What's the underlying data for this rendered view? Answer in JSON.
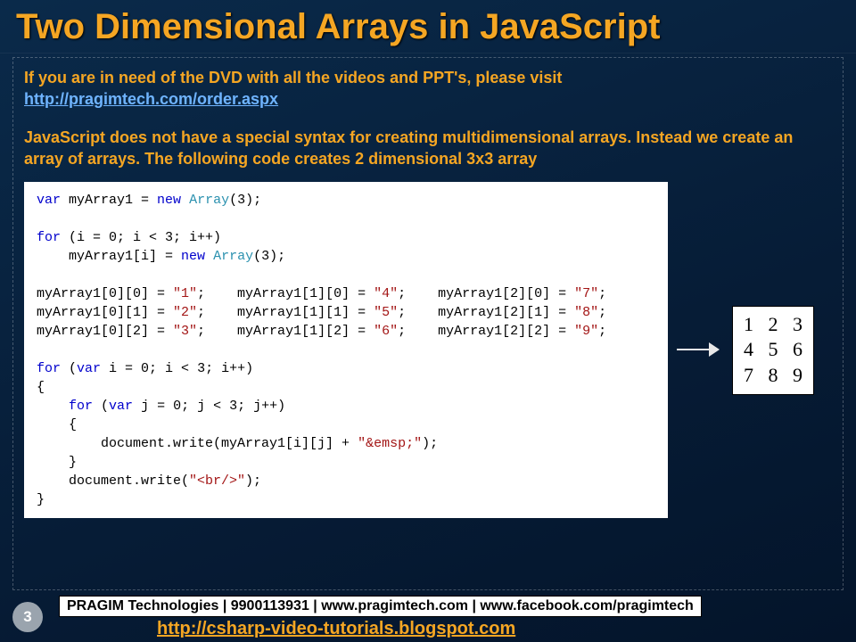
{
  "title": "Two Dimensional Arrays in JavaScript",
  "intro": {
    "line1": "If you are in need of the DVD with all the videos and PPT's, please visit",
    "link_text": "http://pragimtech.com/order.aspx",
    "line2a": "JavaScript does not have a special syntax for creating multidimensional arrays. Instead we create ",
    "line2b": "an array of arrays.",
    "line2c": " The following code creates 2 dimensional 3x3 array"
  },
  "code": {
    "l1a": "var",
    "l1b": " myArray1 = ",
    "l1c": "new",
    "l1d": " ",
    "l1e": "Array",
    "l1f": "(3);",
    "l3a": "for",
    "l3b": " (i = 0; i < 3; i++)",
    "l4a": "    myArray1[i] = ",
    "l4b": "new",
    "l4c": " ",
    "l4d": "Array",
    "l4e": "(3);",
    "l6a": "myArray1[0][0] = ",
    "l6b": "\"1\"",
    "l6c": ";    myArray1[1][0] = ",
    "l6d": "\"4\"",
    "l6e": ";    myArray1[2][0] = ",
    "l6f": "\"7\"",
    "l6g": ";",
    "l7a": "myArray1[0][1] = ",
    "l7b": "\"2\"",
    "l7c": ";    myArray1[1][1] = ",
    "l7d": "\"5\"",
    "l7e": ";    myArray1[2][1] = ",
    "l7f": "\"8\"",
    "l7g": ";",
    "l8a": "myArray1[0][2] = ",
    "l8b": "\"3\"",
    "l8c": ";    myArray1[1][2] = ",
    "l8d": "\"6\"",
    "l8e": ";    myArray1[2][2] = ",
    "l8f": "\"9\"",
    "l8g": ";",
    "l10a": "for",
    "l10b": " (",
    "l10c": "var",
    "l10d": " i = 0; i < 3; i++)",
    "l11": "{",
    "l12a": "    ",
    "l12b": "for",
    "l12c": " (",
    "l12d": "var",
    "l12e": " j = 0; j < 3; j++)",
    "l13": "    {",
    "l14a": "        document.write(myArray1[i][j] + ",
    "l14b": "\"&emsp;\"",
    "l14c": ");",
    "l15": "    }",
    "l16a": "    document.write(",
    "l16b": "\"<br/>\"",
    "l16c": ");",
    "l17": "}"
  },
  "output": {
    "r1": "1   2   3",
    "r2": "4   5   6",
    "r3": "7   8   9"
  },
  "footer": {
    "page": "3",
    "info": "PRAGIM Technologies | 9900113931 | www.pragimtech.com | www.facebook.com/pragimtech",
    "link": "http://csharp-video-tutorials.blogspot.com"
  }
}
